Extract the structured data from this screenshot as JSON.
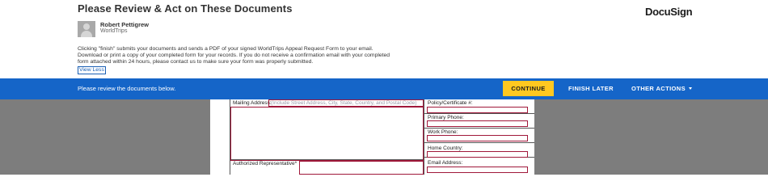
{
  "header": {
    "title": "Please Review & Act on These Documents",
    "logo": "DocuSign",
    "sender": {
      "name": "Robert Pettigrew",
      "org": "WorldTrips"
    },
    "message": "Clicking \"finish\" submits your documents and sends a PDF of your signed WorldTrips Appeal Request Form to your email. Download or print a copy of your completed form for your records. If you do not receive a confirmation email with your completed form attached within 24 hours, please contact us to make sure your form was properly submitted.",
    "view_less": "View Less"
  },
  "action_bar": {
    "message": "Please review the documents below.",
    "continue": "CONTINUE",
    "finish_later": "FINISH LATER",
    "other_actions": "OTHER ACTIONS",
    "colors": {
      "bar": "#1565c8",
      "continue": "#ffc820"
    }
  },
  "document": {
    "mailing_address_label": "Mailing Address:",
    "mailing_address_hint": "(Include Street Address, City, State, Country, and Postal Code)",
    "authorized_rep_label": "Authorized Representative*",
    "policy_label": "Policy/Certificate #:",
    "primary_phone_label": "Primary Phone:",
    "work_phone_label": "Work Phone:",
    "home_country_label": "Home Country:",
    "email_label": "Email Address:"
  }
}
